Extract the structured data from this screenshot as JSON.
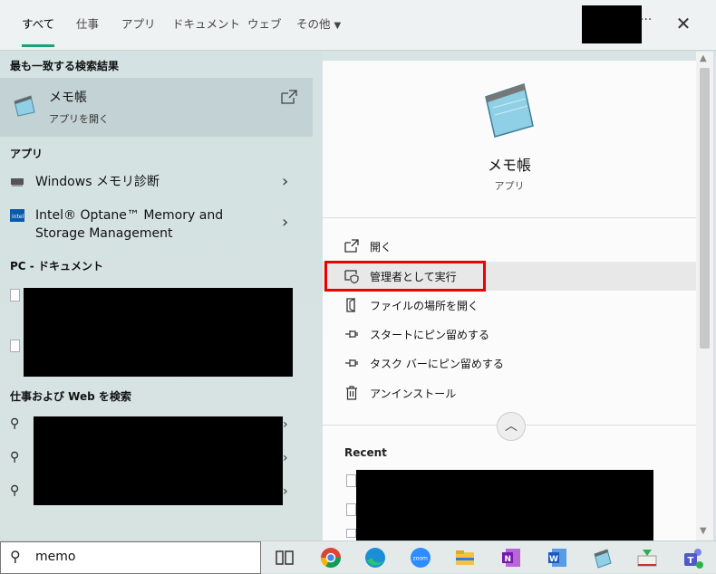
{
  "tabs": [
    {
      "label": "すべて"
    },
    {
      "label": "仕事"
    },
    {
      "label": "アプリ"
    },
    {
      "label": "ドキュメント"
    },
    {
      "label": "ウェブ"
    },
    {
      "label": "その他"
    }
  ],
  "top_more": "···",
  "close_glyph": "✕",
  "best_match": {
    "header": "最も一致する検索結果",
    "title": "メモ帳",
    "subtitle": "アプリを開く"
  },
  "apps": {
    "header": "アプリ",
    "items": [
      {
        "label": "Windows メモリ診断"
      },
      {
        "label_line1": "Intel® Optane™ Memory and",
        "label_line2": "Storage Management"
      }
    ]
  },
  "documents": {
    "header": "PC - ドキュメント"
  },
  "web": {
    "header": "仕事および Web を検索"
  },
  "preview": {
    "title": "メモ帳",
    "subtitle": "アプリ",
    "actions": [
      {
        "label": "開く"
      },
      {
        "label": "管理者として実行"
      },
      {
        "label": "ファイルの場所を開く"
      },
      {
        "label": "スタートにピン留めする"
      },
      {
        "label": "タスク バーにピン留めする"
      },
      {
        "label": "アンインストール"
      }
    ],
    "recent_header": "Recent"
  },
  "taskbar": {
    "search_value": "memo",
    "apps": [
      "task-view",
      "chrome",
      "edge",
      "zoom",
      "file-explorer",
      "onenote",
      "word",
      "notepad-app",
      "mail-app",
      "teams"
    ]
  },
  "colors": {
    "accent": "#1aa07a",
    "highlight_border": "#e00000",
    "redaction": "#000000"
  }
}
